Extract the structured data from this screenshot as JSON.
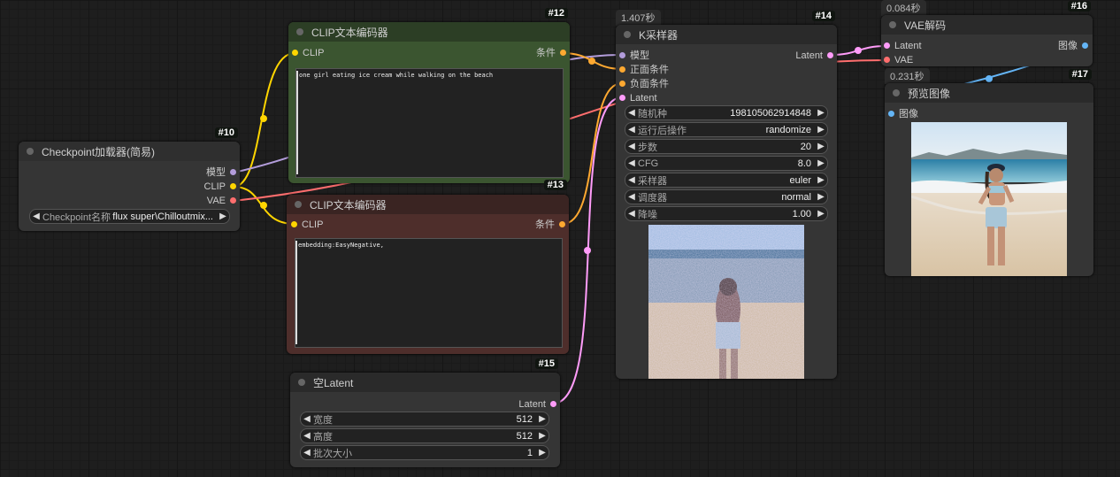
{
  "colors": {
    "clip": "#ffd500",
    "model": "#b39ddb",
    "vae": "#ff6e6e",
    "latent": "#ff9cf9",
    "cond": "#ffa931",
    "image": "#64b5f6"
  },
  "nodes": {
    "checkpoint": {
      "id": "#10",
      "title": "Checkpoint加载器(简易)",
      "outputs": [
        "模型",
        "CLIP",
        "VAE"
      ],
      "widget": {
        "label": "Checkpoint名称",
        "value": "flux super\\Chilloutmix..."
      }
    },
    "clip_pos": {
      "id": "#12",
      "title": "CLIP文本编码器",
      "input": "CLIP",
      "output": "条件",
      "text": "one girl eating ice cream while walking on the beach"
    },
    "clip_neg": {
      "id": "#13",
      "title": "CLIP文本编码器",
      "input": "CLIP",
      "output": "条件",
      "text": "embedding:EasyNegative,"
    },
    "empty_latent": {
      "id": "#15",
      "title": "空Latent",
      "output": "Latent",
      "widgets": [
        {
          "label": "宽度",
          "value": "512"
        },
        {
          "label": "高度",
          "value": "512"
        },
        {
          "label": "批次大小",
          "value": "1"
        }
      ]
    },
    "ksampler": {
      "id": "#14",
      "timing": "1.407秒",
      "title": "K采样器",
      "inputs": [
        "模型",
        "正面条件",
        "负面条件",
        "Latent"
      ],
      "output": "Latent",
      "widgets": [
        {
          "label": "随机种",
          "value": "198105062914848"
        },
        {
          "label": "运行后操作",
          "value": "randomize"
        },
        {
          "label": "步数",
          "value": "20"
        },
        {
          "label": "CFG",
          "value": "8.0"
        },
        {
          "label": "采样器",
          "value": "euler"
        },
        {
          "label": "调度器",
          "value": "normal"
        },
        {
          "label": "降噪",
          "value": "1.00"
        }
      ]
    },
    "vae_decode": {
      "id": "#16",
      "timing": "0.084秒",
      "title": "VAE解码",
      "inputs": [
        "Latent",
        "VAE"
      ],
      "output": "图像"
    },
    "preview": {
      "id": "#17",
      "timing": "0.231秒",
      "title": "预览图像",
      "input": "图像"
    }
  }
}
